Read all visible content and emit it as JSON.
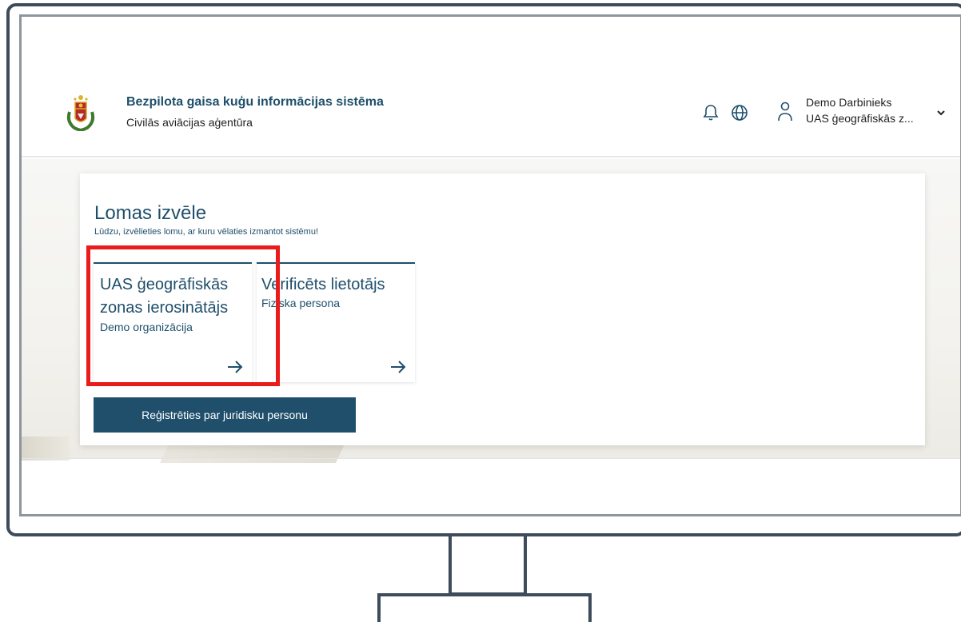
{
  "header": {
    "title": "Bezpilota gaisa kuģu informācijas sistēma",
    "subtitle": "Civilās aviācijas aģentūra",
    "user_name": "Demo Darbinieks",
    "user_role": "UAS ģeogrāfiskās z..."
  },
  "page": {
    "title": "Lomas izvēle",
    "subtitle": "Lūdzu, izvēlieties lomu, ar kuru vēlaties izmantot sistēmu!"
  },
  "roles": [
    {
      "name": "UAS ģeogrāfiskās zonas ierosinātājs",
      "org": "Demo organizācija",
      "icon": "arrow-right-icon"
    },
    {
      "name": "Verificēts lietotājs",
      "org": "Fiziska persona",
      "icon": "arrow-right-icon"
    }
  ],
  "register_button": "Reģistrēties par juridisku personu",
  "icons": {
    "bell": "bell-icon",
    "globe": "globe-icon",
    "user": "user-icon",
    "chevron": "chevron-down-icon"
  },
  "colors": {
    "primary": "#1f4f6b",
    "highlight": "#ea1b1b",
    "frame": "#3d4b5a"
  }
}
